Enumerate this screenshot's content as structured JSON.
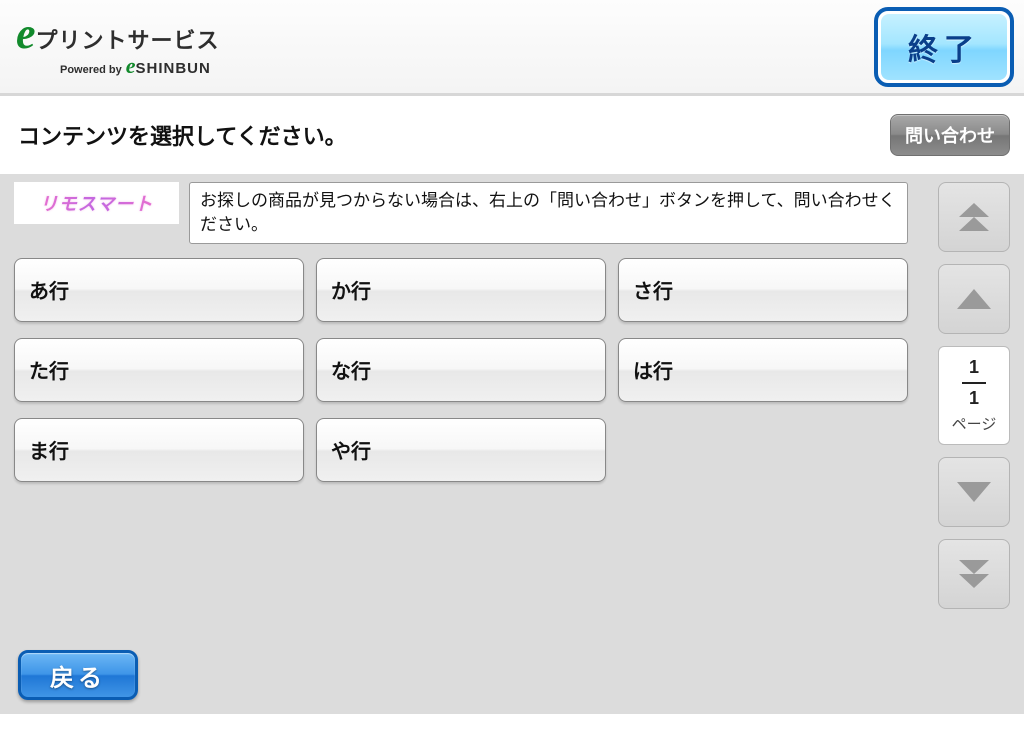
{
  "header": {
    "logo_main": "プリントサービス",
    "logo_powered": "Powered by",
    "logo_sub": "SHINBUN",
    "exit_label": "終了"
  },
  "instruction": "コンテンツを選択してください。",
  "inquiry_label": "問い合わせ",
  "brand_tile": "リモスマート",
  "notice": "お探しの商品が見つからない場合は、右上の「問い合わせ」ボタンを押して、問い合わせください。",
  "categories": [
    "あ行",
    "か行",
    "さ行",
    "た行",
    "な行",
    "は行",
    "ま行",
    "や行"
  ],
  "pager": {
    "current": "1",
    "total": "1",
    "unit": "ページ"
  },
  "back_label": "戻る"
}
